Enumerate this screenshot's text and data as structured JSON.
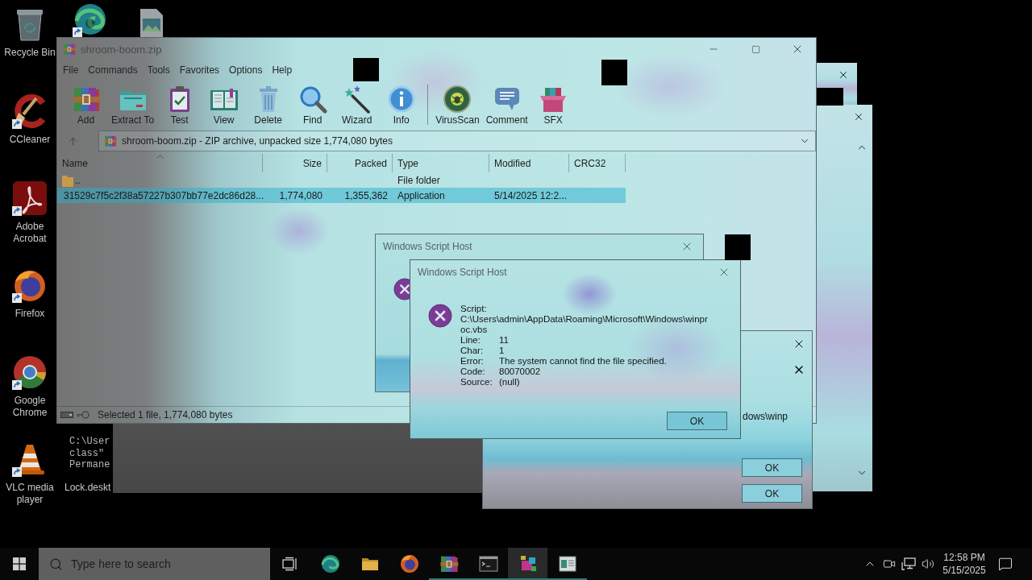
{
  "desktop": {
    "icons": [
      {
        "kind": "recycle-bin",
        "label": "Recycle Bin",
        "shortcut": false
      },
      {
        "kind": "swirl",
        "shortcut": true
      },
      {
        "kind": "image-file",
        "shortcut": false
      },
      {
        "kind": "brush",
        "label": "CCleaner",
        "shortcut": true
      },
      {
        "kind": "pdf",
        "label": "Adobe Acrobat",
        "shortcut": true
      },
      {
        "kind": "fox",
        "label": "Firefox",
        "shortcut": true
      },
      {
        "kind": "ring",
        "label": "Google Chrome",
        "shortcut": true
      },
      {
        "kind": "cone",
        "label": "VLC media player",
        "shortcut": true
      },
      {
        "kind": "text-file",
        "label": "Lock.deskt",
        "preview_lines": [
          "C:\\User",
          "class\"",
          "Permane"
        ]
      }
    ]
  },
  "archive": {
    "title": "shroom-boom.zip",
    "menu": [
      "File",
      "Commands",
      "Tools",
      "Favorites",
      "Options",
      "Help"
    ],
    "toolbar": [
      [
        {
          "kind": "add",
          "label": "Add"
        },
        {
          "kind": "extract",
          "label": "Extract To"
        },
        {
          "kind": "test",
          "label": "Test"
        },
        {
          "kind": "view",
          "label": "View"
        },
        {
          "kind": "delete",
          "label": "Delete"
        },
        {
          "kind": "find",
          "label": "Find"
        },
        {
          "kind": "wizard",
          "label": "Wizard"
        },
        {
          "kind": "info",
          "label": "Info"
        }
      ],
      [
        {
          "kind": "virusscan",
          "label": "VirusScan"
        },
        {
          "kind": "comment",
          "label": "Comment"
        },
        {
          "kind": "sfx",
          "label": "SFX"
        }
      ]
    ],
    "address": "shroom-boom.zip - ZIP archive, unpacked size 1,774,080 bytes",
    "columns": [
      {
        "label": "Name",
        "sorted": true
      },
      {
        "label": "Size",
        "sorted": false
      },
      {
        "label": "Packed",
        "sorted": false
      },
      {
        "label": "Type",
        "sorted": false
      },
      {
        "label": "Modified",
        "sorted": false
      },
      {
        "label": "CRC32",
        "sorted": false
      }
    ],
    "rows": [
      {
        "kind": "folder",
        "name": "..",
        "type": "File folder",
        "selected": false
      },
      {
        "kind": "application",
        "name": "31529c7f5c2f38a57227b307bb77e2dc86d28...",
        "size": "1,774,080",
        "packed": "1,355,362",
        "type": "Application",
        "modified": "5/14/2025 12:2...",
        "selected": true
      }
    ],
    "status": "Selected 1 file, 1,774,080 bytes"
  },
  "dialogs": [
    {
      "kind": "back",
      "title": "Windows Script Host"
    },
    {
      "kind": "ghost",
      "fragment": "dows\\winp",
      "buttons": [
        "OK",
        "OK"
      ]
    },
    {
      "kind": "front",
      "title": "Windows Script Host",
      "script_label": "Script:",
      "script_path": [
        "C:\\Users\\admin\\AppData\\Roaming\\Microsoft\\Windows\\winpr",
        "oc.vbs"
      ],
      "fields": [
        {
          "label": "Line:",
          "value": "11"
        },
        {
          "label": "Char:",
          "value": "1"
        },
        {
          "label": "Error:",
          "value": "The system cannot find the file specified."
        },
        {
          "label": "Code:",
          "value": "80070002"
        },
        {
          "label": "Source:",
          "value": "(null)"
        }
      ],
      "buttons": [
        "OK"
      ]
    }
  ],
  "taskbar": {
    "search": {
      "placeholder": "Type here to search"
    },
    "apps": [
      {
        "kind": "swirl",
        "running": false,
        "selected": false
      },
      {
        "kind": "folder",
        "running": false,
        "selected": false
      },
      {
        "kind": "fox",
        "running": false,
        "selected": false
      },
      {
        "kind": "books",
        "running": true,
        "selected": false
      },
      {
        "kind": "terminal",
        "running": true,
        "selected": false
      },
      {
        "kind": "shapes",
        "running": true,
        "selected": true
      },
      {
        "kind": "window",
        "running": true,
        "selected": false
      }
    ],
    "clock": {
      "time": "12:58 PM",
      "date": "5/15/2025"
    }
  }
}
